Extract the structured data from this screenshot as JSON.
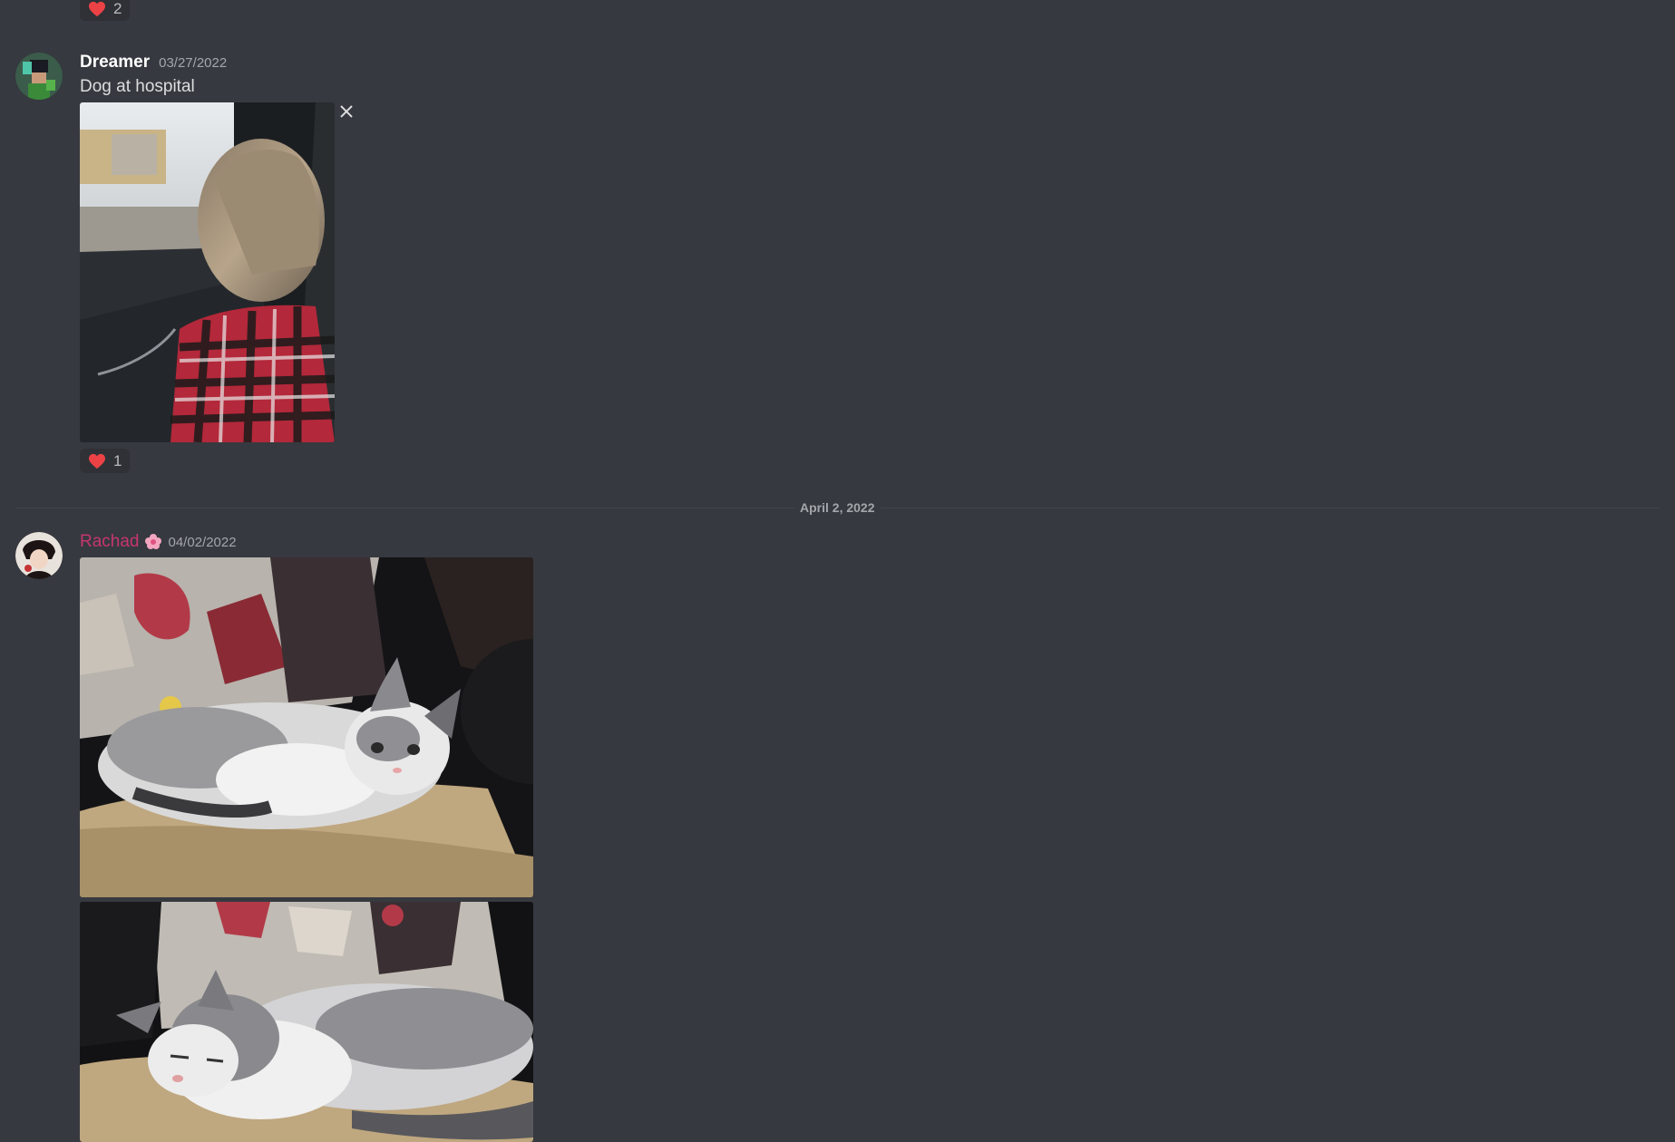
{
  "colors": {
    "background": "#36393f",
    "reaction_bg": "#2f3136",
    "heart": "#ed4245",
    "rachad_name": "#c7366f"
  },
  "top_reaction": {
    "emoji": "heart-icon",
    "count": "2"
  },
  "messages": [
    {
      "username": "Dreamer",
      "timestamp": "03/27/2022",
      "text": "Dog at hospital",
      "attachment": "dog-in-car-photo",
      "reaction": {
        "emoji": "heart-icon",
        "count": "1"
      }
    },
    {
      "username": "Rachad",
      "username_emoji": "flower-emoji-icon",
      "timestamp": "04/02/2022",
      "attachments": [
        "cat-resting-photo",
        "cat-sleeping-photo"
      ]
    }
  ],
  "date_divider": "April 2, 2022"
}
